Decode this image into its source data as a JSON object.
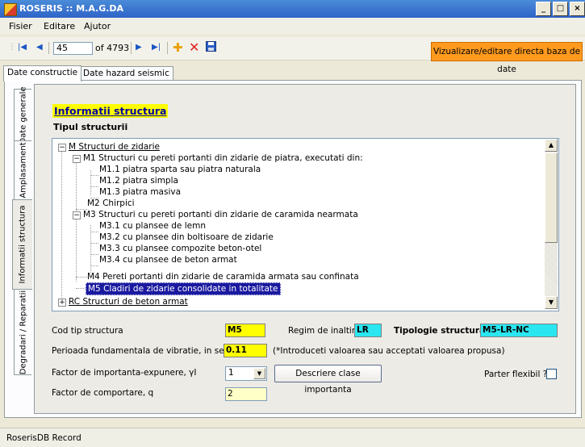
{
  "window": {
    "title": "ROSERIS :: M.A.G.DA",
    "min": "_",
    "max": "□",
    "close": "×"
  },
  "menu": [
    "Fisier",
    "Editare",
    "Ajutor"
  ],
  "navigator": {
    "position": "45",
    "count": "of 4793"
  },
  "toolbar": {
    "visualize_button": "Vizualizare/editare directa baza de date"
  },
  "outer_tabs": [
    "Date constructie",
    "Date hazard seismic"
  ],
  "side_tabs": [
    "Date generale",
    "Amplasament",
    "Informatii structura",
    "Degradari / Reparatii"
  ],
  "section": {
    "heading": "Informatii structura",
    "subheading": "Tipul structurii"
  },
  "tree": [
    {
      "pm": "−",
      "text": "M     Structuri de zidarie"
    },
    {
      "pm": "−",
      "text": "M1     Structuri cu pereti portanti din zidarie de piatra, executati din:"
    },
    {
      "text": "M1.1  piatra sparta sau piatra naturala"
    },
    {
      "text": "M1.2  piatra simpla"
    },
    {
      "text": "M1.3  piatra masiva"
    },
    {
      "text": "M2    Chirpici"
    },
    {
      "pm": "−",
      "text": "M3    Structuri cu pereti portanti din zidarie de caramida nearmata"
    },
    {
      "text": "M3.1  cu plansee de lemn"
    },
    {
      "text": "M3.2  cu plansee din boltisoare de zidarie"
    },
    {
      "text": "M3.3  cu plansee compozite beton-otel"
    },
    {
      "text": "M3.4  cu plansee de beton armat"
    },
    {
      "text": "M4    Pereti portanti din zidarie de caramida armata sau confinata"
    },
    {
      "text": "M5    Cladiri de zidarie consolidate in totalitate",
      "selected": true
    },
    {
      "pm": "+",
      "text": "RC    Structuri de beton armat"
    }
  ],
  "form": {
    "cod_label": "Cod tip structura",
    "cod_value": "M5",
    "regim_label": "Regim de inaltime",
    "regim_value": "LR",
    "tipologie_label": "Tipologie structura",
    "tipologie_value": "M5-LR-NC",
    "perioada_label": "Perioada fundamentala de vibratie, in secunde*",
    "perioada_value": "0.11",
    "perioada_note": "(*Introduceti valoarea sau acceptati valoarea propusa)",
    "importanta_label": "Factor de importanta-expunere, γI",
    "importanta_value": "1",
    "descriere_button": "Descriere clase importanta",
    "parter_label": "Parter flexibil ?",
    "comportare_label": "Factor de comportare,  q",
    "comportare_value": "2"
  },
  "status": "RoserisDB Record",
  "colors": {
    "title_bar": "#2f63c8",
    "highlight_yellow": "#ffff00",
    "cyan": "#2ae6f0",
    "orange_button": "#ff9a1f",
    "selection": "#1a1aa0"
  }
}
